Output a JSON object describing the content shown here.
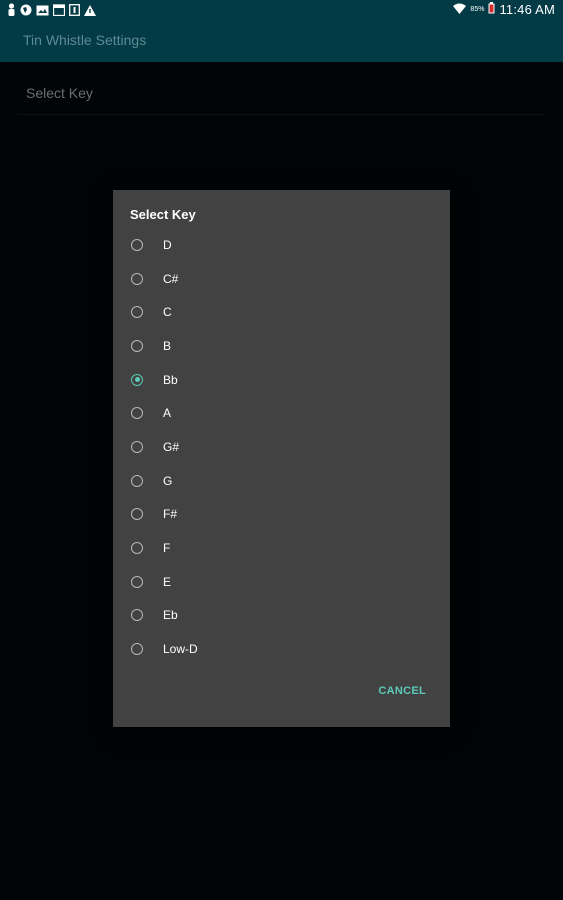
{
  "status_bar": {
    "left_icons": [
      "person-icon",
      "globe-icon",
      "photo-icon",
      "calendar-icon",
      "notification-icon",
      "warning-icon"
    ],
    "battery_percent": "85%",
    "time": "11:46 AM"
  },
  "app_bar": {
    "title": "Tin Whistle Settings"
  },
  "preferences": {
    "select_key_label": "Select Key"
  },
  "dialog": {
    "title": "Select Key",
    "selected": "Bb",
    "options": [
      "D",
      "C#",
      "C",
      "B",
      "Bb",
      "A",
      "G#",
      "G",
      "F#",
      "F",
      "E",
      "Eb",
      "Low-D"
    ],
    "cancel_label": "CANCEL"
  },
  "colors": {
    "app_bar": "#023a45",
    "dialog_bg": "#424242",
    "accent": "#5ccab8",
    "background": "#000307"
  }
}
